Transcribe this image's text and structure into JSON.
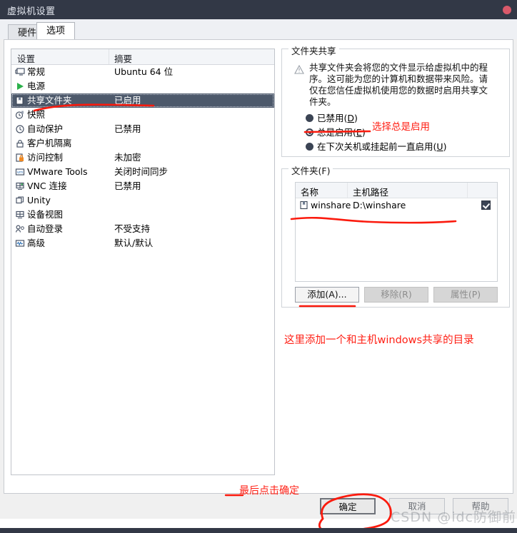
{
  "window": {
    "title": "虚拟机设置",
    "close_icon": "close-dot-icon"
  },
  "tabs": [
    {
      "label": "硬件",
      "active": false
    },
    {
      "label": "选项",
      "active": true
    }
  ],
  "settings_list": {
    "columns": [
      "设置",
      "摘要"
    ],
    "rows": [
      {
        "icon": "monitor-icon",
        "name": "常规",
        "summary": "Ubuntu 64 位",
        "selected": false
      },
      {
        "icon": "power-play-icon",
        "name": "电源",
        "summary": "",
        "selected": false
      },
      {
        "icon": "folder-icon",
        "name": "共享文件夹",
        "summary": "已启用",
        "selected": true
      },
      {
        "icon": "snapshot-clock-icon",
        "name": "快照",
        "summary": "",
        "selected": false
      },
      {
        "icon": "autoprotect-clock-icon",
        "name": "自动保护",
        "summary": "已禁用",
        "selected": false
      },
      {
        "icon": "lock-icon",
        "name": "客户机隔离",
        "summary": "",
        "selected": false
      },
      {
        "icon": "access-control-icon",
        "name": "访问控制",
        "summary": "未加密",
        "selected": false
      },
      {
        "icon": "vmware-tools-icon",
        "name": "VMware Tools",
        "summary": "关闭时间同步",
        "selected": false
      },
      {
        "icon": "vnc-icon",
        "name": "VNC 连接",
        "summary": "已禁用",
        "selected": false
      },
      {
        "icon": "unity-icon",
        "name": "Unity",
        "summary": "",
        "selected": false
      },
      {
        "icon": "device-view-icon",
        "name": "设备视图",
        "summary": "",
        "selected": false
      },
      {
        "icon": "auto-login-icon",
        "name": "自动登录",
        "summary": "不受支持",
        "selected": false
      },
      {
        "icon": "advanced-icon",
        "name": "高级",
        "summary": "默认/默认",
        "selected": false
      }
    ]
  },
  "folder_sharing": {
    "legend": "文件夹共享",
    "warning_icon": "warning-triangle-icon",
    "warning_text": "共享文件夹会将您的文件显示给虚拟机中的程序。这可能为您的计算机和数据带来风险。请仅在您信任虚拟机使用您的数据时启用共享文件夹。",
    "options": [
      {
        "label": "已禁用",
        "mnemonic": "D",
        "checked": false
      },
      {
        "label": "总是启用",
        "mnemonic": "E",
        "checked": true
      },
      {
        "label": "在下次关机或挂起前一直启用",
        "mnemonic": "U",
        "checked": false
      }
    ]
  },
  "folders": {
    "legend": "文件夹(F)",
    "legend_mnemonic": "F",
    "columns": [
      "名称",
      "主机路径"
    ],
    "rows": [
      {
        "icon": "folder-icon",
        "name": "winshare",
        "host_path": "D:\\winshare",
        "enabled": true
      }
    ],
    "buttons": [
      {
        "label": "添加(A)...",
        "enabled": true
      },
      {
        "label": "移除(R)",
        "enabled": false
      },
      {
        "label": "属性(P)",
        "enabled": false
      }
    ]
  },
  "annotations": {
    "color": "#ff1f14",
    "always_enable": "选择总是启用",
    "add_directory": "这里添加一个和主机windows共享的目录",
    "click_confirm": "最后点击确定"
  },
  "footer": {
    "ok": "确定",
    "cancel": "取消",
    "help": "帮助"
  },
  "watermark": "CSDN @idc防御前端"
}
